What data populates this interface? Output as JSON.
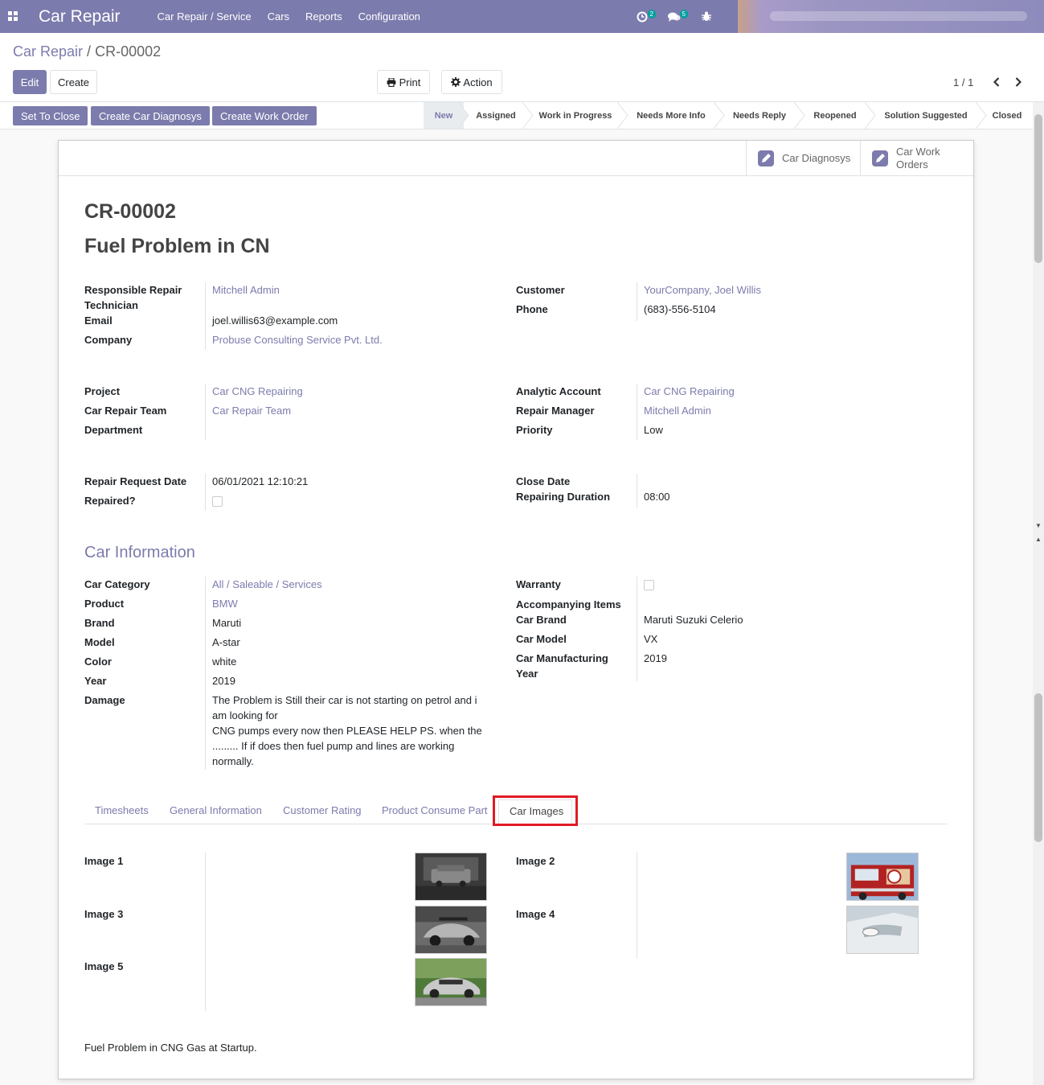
{
  "navbar": {
    "app_title": "Car Repair",
    "menu": [
      "Car Repair / Service",
      "Cars",
      "Reports",
      "Configuration"
    ],
    "activity_count": "2",
    "message_count": "5"
  },
  "breadcrumb": {
    "parent": "Car Repair",
    "separator": "/",
    "current": "CR-00002"
  },
  "toolbar": {
    "edit_label": "Edit",
    "create_label": "Create",
    "print_label": "Print",
    "action_label": "Action"
  },
  "pager": {
    "value": "1 / 1"
  },
  "statusbar": {
    "buttons": [
      "Set To Close",
      "Create Car Diagnosys",
      "Create Work Order"
    ],
    "stages": [
      "New",
      "Assigned",
      "Work in Progress",
      "Needs More Info",
      "Needs Reply",
      "Reopened",
      "Solution Suggested",
      "Closed"
    ],
    "active_stage": "New"
  },
  "smart_buttons": {
    "diagnosys": "Car Diagnosys",
    "work_orders_line1": "Car Work",
    "work_orders_line2": "Orders"
  },
  "record": {
    "reference": "CR-00002",
    "name": "Fuel Problem in CN",
    "responsible_label_1": "Responsible Repair",
    "responsible_label_2": "Technician",
    "responsible": "Mitchell Admin",
    "email_label": "Email",
    "email": "joel.willis63@example.com",
    "company_label": "Company",
    "company": "Probuse Consulting Service Pvt. Ltd.",
    "customer_label": "Customer",
    "customer": "YourCompany, Joel Willis",
    "phone_label": "Phone",
    "phone": "(683)-556-5104",
    "project_label": "Project",
    "project": "Car CNG Repairing",
    "team_label": "Car Repair Team",
    "team": "Car Repair Team",
    "department_label": "Department",
    "analytic_label": "Analytic Account",
    "analytic": "Car CNG Repairing",
    "manager_label": "Repair Manager",
    "manager": "Mitchell Admin",
    "priority_label": "Priority",
    "priority": "Low",
    "request_date_label": "Repair Request Date",
    "request_date": "06/01/2021 12:10:21",
    "repaired_label": "Repaired?",
    "close_date_label": "Close Date",
    "duration_label": "Repairing Duration",
    "duration": "08:00"
  },
  "car_info": {
    "section_title": "Car Information",
    "category_label": "Car Category",
    "category": "All / Saleable / Services",
    "product_label": "Product",
    "product": "BMW",
    "brand_label": "Brand",
    "brand": "Maruti",
    "model_label": "Model",
    "model": "A-star",
    "color_label": "Color",
    "color": "white",
    "year_label": "Year",
    "year": "2019",
    "damage_label": "Damage",
    "damage_lines": [
      "The Problem is Still their car is not starting on petrol and i",
      "am looking for",
      "CNG pumps every now then PLEASE HELP PS. when the",
      "......... If if does then fuel pump and lines are working",
      "normally."
    ],
    "warranty_label": "Warranty",
    "accompanying_label": "Accompanying Items",
    "car_brand_label": "Car Brand",
    "car_brand": "Maruti Suzuki Celerio",
    "car_model_label": "Car Model",
    "car_model": "VX",
    "mfg_year_label_1": "Car Manufacturing",
    "mfg_year_label_2": "Year",
    "mfg_year": "2019"
  },
  "tabs": [
    "Timesheets",
    "General Information",
    "Customer Rating",
    "Product Consume Part",
    "Car Images"
  ],
  "active_tab": "Car Images",
  "images": {
    "image1_label": "Image 1",
    "image2_label": "Image 2",
    "image3_label": "Image 3",
    "image4_label": "Image 4",
    "image5_label": "Image 5"
  },
  "footer_note": "Fuel Problem in CNG Gas at Startup.",
  "colors": {
    "brand": "#7c7bad",
    "highlight": "#e01b24",
    "text": "#212529"
  }
}
